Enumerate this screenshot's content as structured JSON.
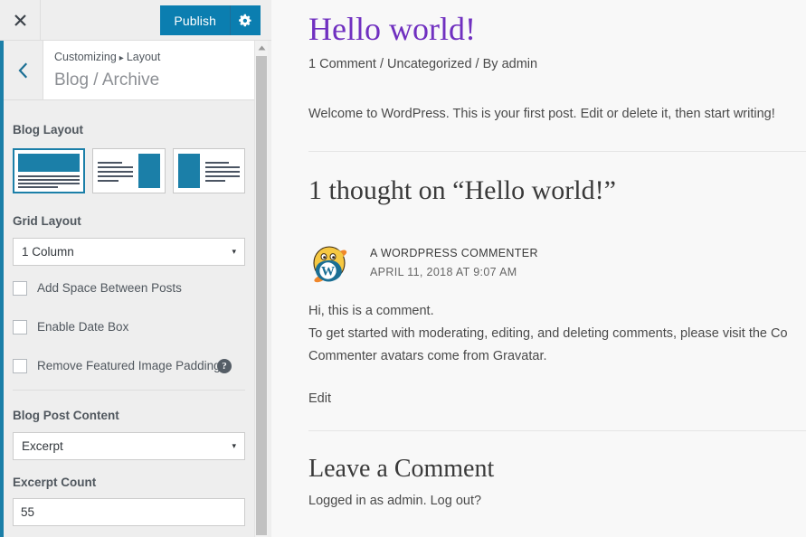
{
  "customizer": {
    "close_icon": "close-icon",
    "publish_label": "Publish",
    "settings_icon": "gear-icon",
    "back_icon": "chevron-left-icon",
    "breadcrumb": {
      "root": "Customizing",
      "separator": "▸",
      "current": "Layout"
    },
    "panel_title": "Blog / Archive",
    "controls": {
      "blog_layout": {
        "label": "Blog Layout",
        "options": [
          {
            "name": "layout-image-top",
            "selected": true
          },
          {
            "name": "layout-image-right",
            "selected": false
          },
          {
            "name": "layout-image-left",
            "selected": false
          }
        ]
      },
      "grid_layout": {
        "label": "Grid Layout",
        "value": "1 Column",
        "caret": "▾"
      },
      "add_space_between_posts": {
        "label": "Add Space Between Posts",
        "checked": false
      },
      "enable_date_box": {
        "label": "Enable Date Box",
        "checked": false
      },
      "remove_featured_image_padding": {
        "label": "Remove Featured Image Padding",
        "checked": false,
        "help_icon": "help-icon",
        "help_glyph": "?"
      },
      "blog_post_content": {
        "label": "Blog Post Content",
        "value": "Excerpt",
        "caret": "▾"
      },
      "excerpt_count": {
        "label": "Excerpt Count",
        "value": "55"
      }
    },
    "scrollbar": {
      "up_arrow_icon": "scroll-up-arrow-icon"
    }
  },
  "preview": {
    "post": {
      "title": "Hello world!",
      "meta": "1 Comment / Uncategorized / By admin",
      "body": "Welcome to WordPress. This is your first post. Edit or delete it, then start writing!"
    },
    "comments": {
      "heading": "1 thought on “Hello world!”",
      "items": [
        {
          "avatar_icon": "wordpress-wapuu-avatar-icon",
          "author": "A WORDPRESS COMMENTER",
          "date": "APRIL 11, 2018 AT 9:07 AM",
          "lines": [
            "Hi, this is a comment.",
            "To get started with moderating, editing, and deleting comments, please visit the Co",
            "Commenter avatars come from Gravatar."
          ],
          "edit_label": "Edit"
        }
      ]
    },
    "comment_form": {
      "heading": "Leave a Comment",
      "logged_in_text": "Logged in as admin. Log out?"
    }
  },
  "colors": {
    "wp_blue": "#0b7eb0",
    "accent_strip": "#1b7fa8",
    "title_purple": "#7030c0",
    "sidebar_bg": "#eeeeee",
    "preview_bg": "#f8f8f8"
  }
}
